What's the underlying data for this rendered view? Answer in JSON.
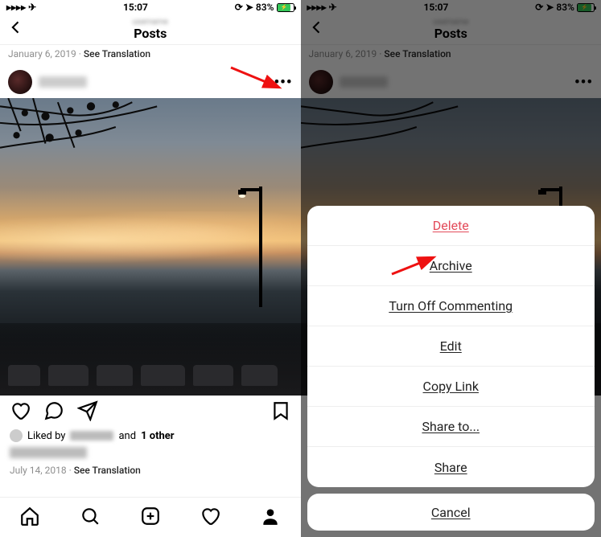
{
  "status": {
    "time": "15:07",
    "battery_pct": "83%",
    "icons": {
      "airplane": "airplane-icon",
      "lock": "lock-rotation-icon",
      "location": "location-icon",
      "charging": "charging-icon"
    }
  },
  "nav": {
    "title": "Posts",
    "sub_hidden": "username"
  },
  "top_meta": {
    "date": "January 6, 2019",
    "sep": " · ",
    "translate": "See Translation"
  },
  "post": {
    "liked_by_prefix": "Liked by",
    "liked_by_and": "and",
    "liked_by_other": "1 other",
    "date": "July 14, 2018",
    "translate": "See Translation"
  },
  "sheet": {
    "items": [
      {
        "label": "Delete",
        "destructive": true
      },
      {
        "label": "Archive",
        "destructive": false
      },
      {
        "label": "Turn Off Commenting",
        "destructive": false
      },
      {
        "label": "Edit",
        "destructive": false
      },
      {
        "label": "Copy Link",
        "destructive": false
      },
      {
        "label": "Share to...",
        "destructive": false
      },
      {
        "label": "Share",
        "destructive": false
      }
    ],
    "cancel": "Cancel"
  }
}
